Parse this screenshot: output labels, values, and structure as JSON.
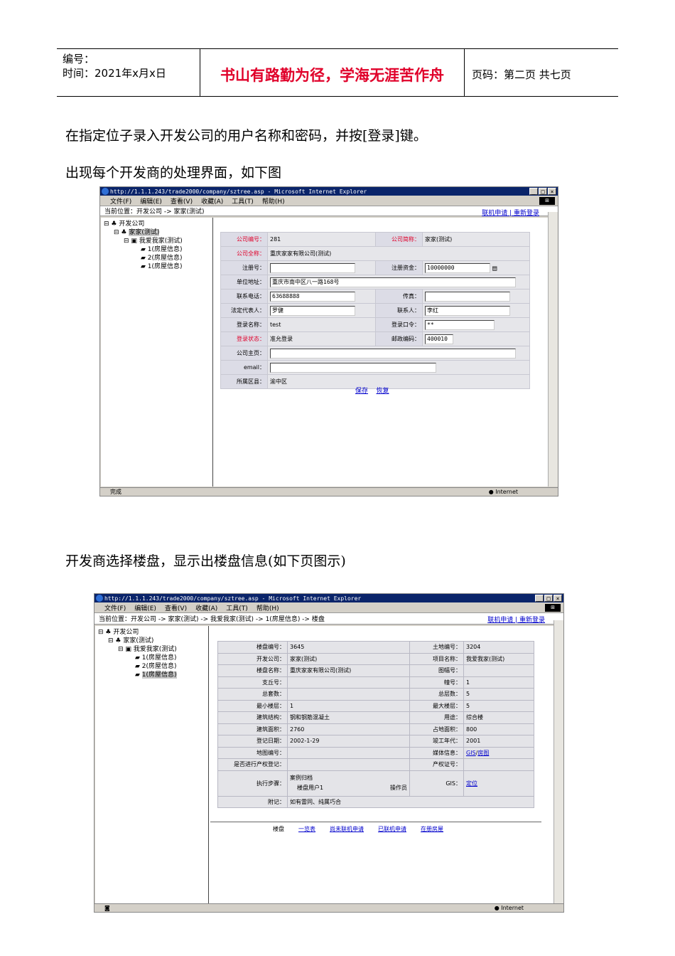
{
  "header": {
    "number_label": "编号：",
    "time_label": "时间：2021年x月x日",
    "slogan": "书山有路勤为径，学海无涯苦作舟",
    "page_label": "页码：第二页  共七页"
  },
  "paragraphs": {
    "p1": "在指定位子录入开发公司的用户名称和密码，并按[登录]键。",
    "p2": "出现每个开发商的处理界面，如下图",
    "p3": "开发商选择楼盘，显示出楼盘信息(如下页图示)"
  },
  "browser": {
    "title": "http://1.1.1.243/trade2000/company/sztree.asp - Microsoft Internet Explorer",
    "menu": [
      "文件(F)",
      "编辑(E)",
      "查看(V)",
      "收藏(A)",
      "工具(T)",
      "帮助(H)"
    ],
    "status_internet": "Internet"
  },
  "shot1": {
    "location": "当前位置：开发公司 -> 家家(测试)",
    "links": [
      "联机申请",
      "重新登录"
    ],
    "tree": [
      "开发公司",
      "家家(测试)",
      "我爱我家(测试)",
      "1(房屋信息)",
      "2(房屋信息)",
      "1(房屋信息)"
    ],
    "status": "完成",
    "form": {
      "company_no_label": "公司编号：",
      "company_no": "281",
      "short_name_label": "公司简称：",
      "short_name": "家家(测试)",
      "full_name_label": "公司全称：",
      "full_name": "重庆家家有限公司(测试)",
      "reg_no_label": "注册号：",
      "capital_label": "注册资金：",
      "capital": "10000000",
      "address_label": "单位地址：",
      "address": "重庆市南中区八一路168号",
      "phone_label": "联系电话：",
      "phone": "63688888",
      "fax_label": "传真：",
      "legal_label": "法定代表人：",
      "legal": "罗健",
      "contact_label": "联系人：",
      "contact": "李红",
      "login_name_label": "登录名称：",
      "login_name": "test",
      "password_label": "登录口令：",
      "password": "**",
      "login_status_label": "登录状态：",
      "login_status": "准允登录",
      "postcode_label": "邮政编码：",
      "postcode": "400010",
      "homepage_label": "公司主页：",
      "email_label": "email：",
      "district_label": "所属区县：",
      "district": "渝中区"
    },
    "save": "保存",
    "restore": "恢复"
  },
  "shot2": {
    "location": "当前位置：开发公司 -> 家家(测试) -> 我爱我家(测试) -> 1(房屋信息) -> 楼盘",
    "links": [
      "联机申请",
      "重新登录"
    ],
    "tree": [
      "开发公司",
      "家家(测试)",
      "我爱我家(测试)",
      "1(房屋信息)",
      "2(房屋信息)",
      "1(房屋信息)"
    ],
    "rows": [
      [
        "楼盘编号：",
        "3645",
        "土地编号：",
        "3204"
      ],
      [
        "开发公司：",
        "家家(测试)",
        "项目名称：",
        "我爱我家(测试)"
      ],
      [
        "楼盘名称：",
        "重庆家家有限公司(测试)",
        "图幅号：",
        ""
      ],
      [
        "支丘号：",
        "",
        "幢号：",
        "1"
      ],
      [
        "总套数：",
        "",
        "总层数：",
        "5"
      ],
      [
        "最小楼层：",
        "1",
        "最大楼层：",
        "5"
      ],
      [
        "建筑结构：",
        "钢和钢筋混凝土",
        "用途：",
        "综合楼"
      ],
      [
        "建筑面积：",
        "2760",
        "占地面积：",
        "800"
      ],
      [
        "登记日期：",
        "2002-1-29",
        "竣工年代：",
        "2001"
      ],
      [
        "地图编号：",
        "",
        "媒体信息：",
        ""
      ],
      [
        "是否进行产权登记：",
        "",
        "产权证号：",
        ""
      ]
    ],
    "media_links": [
      "GIS",
      "房图"
    ],
    "exec_label": "执行步骤：",
    "exec_line1": "案例归档",
    "exec_operator": "操作员",
    "exec_line2": "楼盘用户1",
    "gis_label": "GIS：",
    "gis_link": "定位",
    "remark_label": "附记：",
    "remark": "如有雷同、纯属巧合",
    "bottom_label": "楼盘",
    "bottom_links": [
      "一览表",
      "尚未联机申请",
      "已联机申请",
      "在册房屋"
    ]
  }
}
